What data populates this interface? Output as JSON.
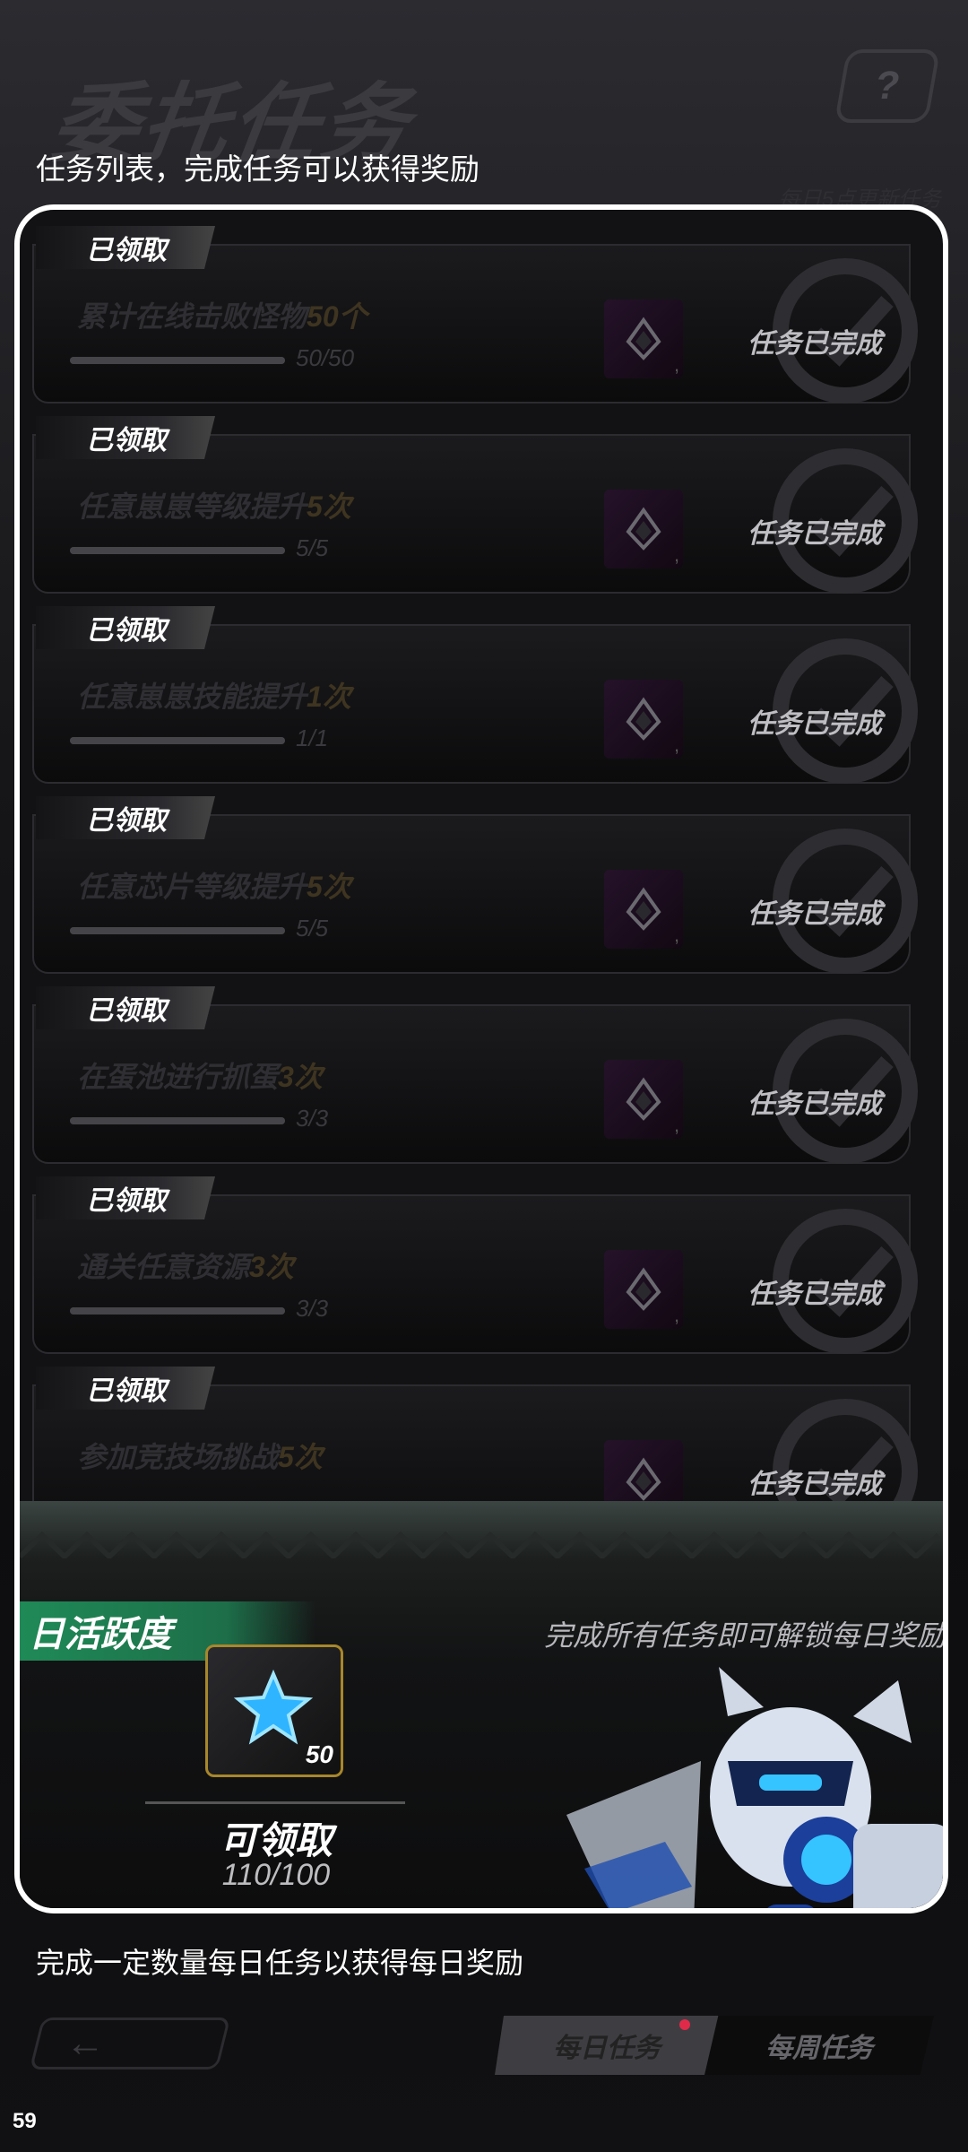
{
  "header": {
    "title": "委托任务",
    "subtitle": "任务列表，完成任务可以获得奖励",
    "refresh_note": "每日5点更新任务",
    "help_icon": "help-icon"
  },
  "tasks": [
    {
      "tag": "已领取",
      "name": "累计在线击败怪物",
      "highlight": "50个",
      "progress": "50/50",
      "status": "任务已完成",
      "reward_count": ","
    },
    {
      "tag": "已领取",
      "name": "任意崽崽等级提升",
      "highlight": "5次",
      "progress": "5/5",
      "status": "任务已完成",
      "reward_count": ","
    },
    {
      "tag": "已领取",
      "name": "任意崽崽技能提升",
      "highlight": "1次",
      "progress": "1/1",
      "status": "任务已完成",
      "reward_count": ","
    },
    {
      "tag": "已领取",
      "name": "任意芯片等级提升",
      "highlight": "5次",
      "progress": "5/5",
      "status": "任务已完成",
      "reward_count": ","
    },
    {
      "tag": "已领取",
      "name": "在蛋池进行抓蛋",
      "highlight": "3次",
      "progress": "3/3",
      "status": "任务已完成",
      "reward_count": ","
    },
    {
      "tag": "已领取",
      "name": "通关任意资源",
      "highlight": "3次",
      "progress": "3/3",
      "status": "任务已完成",
      "reward_count": ","
    },
    {
      "tag": "已领取",
      "name": "参加竞技场挑战",
      "highlight": "5次",
      "progress": "",
      "status": "任务已完成",
      "reward_count": ""
    }
  ],
  "daily": {
    "header": "日活跃度",
    "description": "完成所有任务即可解锁每日奖励",
    "reward_qty": "50",
    "claim_label": "可领取",
    "points": "110/100"
  },
  "footer": {
    "note": "完成一定数量每日任务以获得每日奖励",
    "tab_daily": "每日任务",
    "tab_weekly": "每周任务",
    "page_number": "59"
  },
  "colors": {
    "accent_green": "#1f8a57",
    "gold_border": "#a8872a",
    "notification_dot": "#e02a4a"
  }
}
